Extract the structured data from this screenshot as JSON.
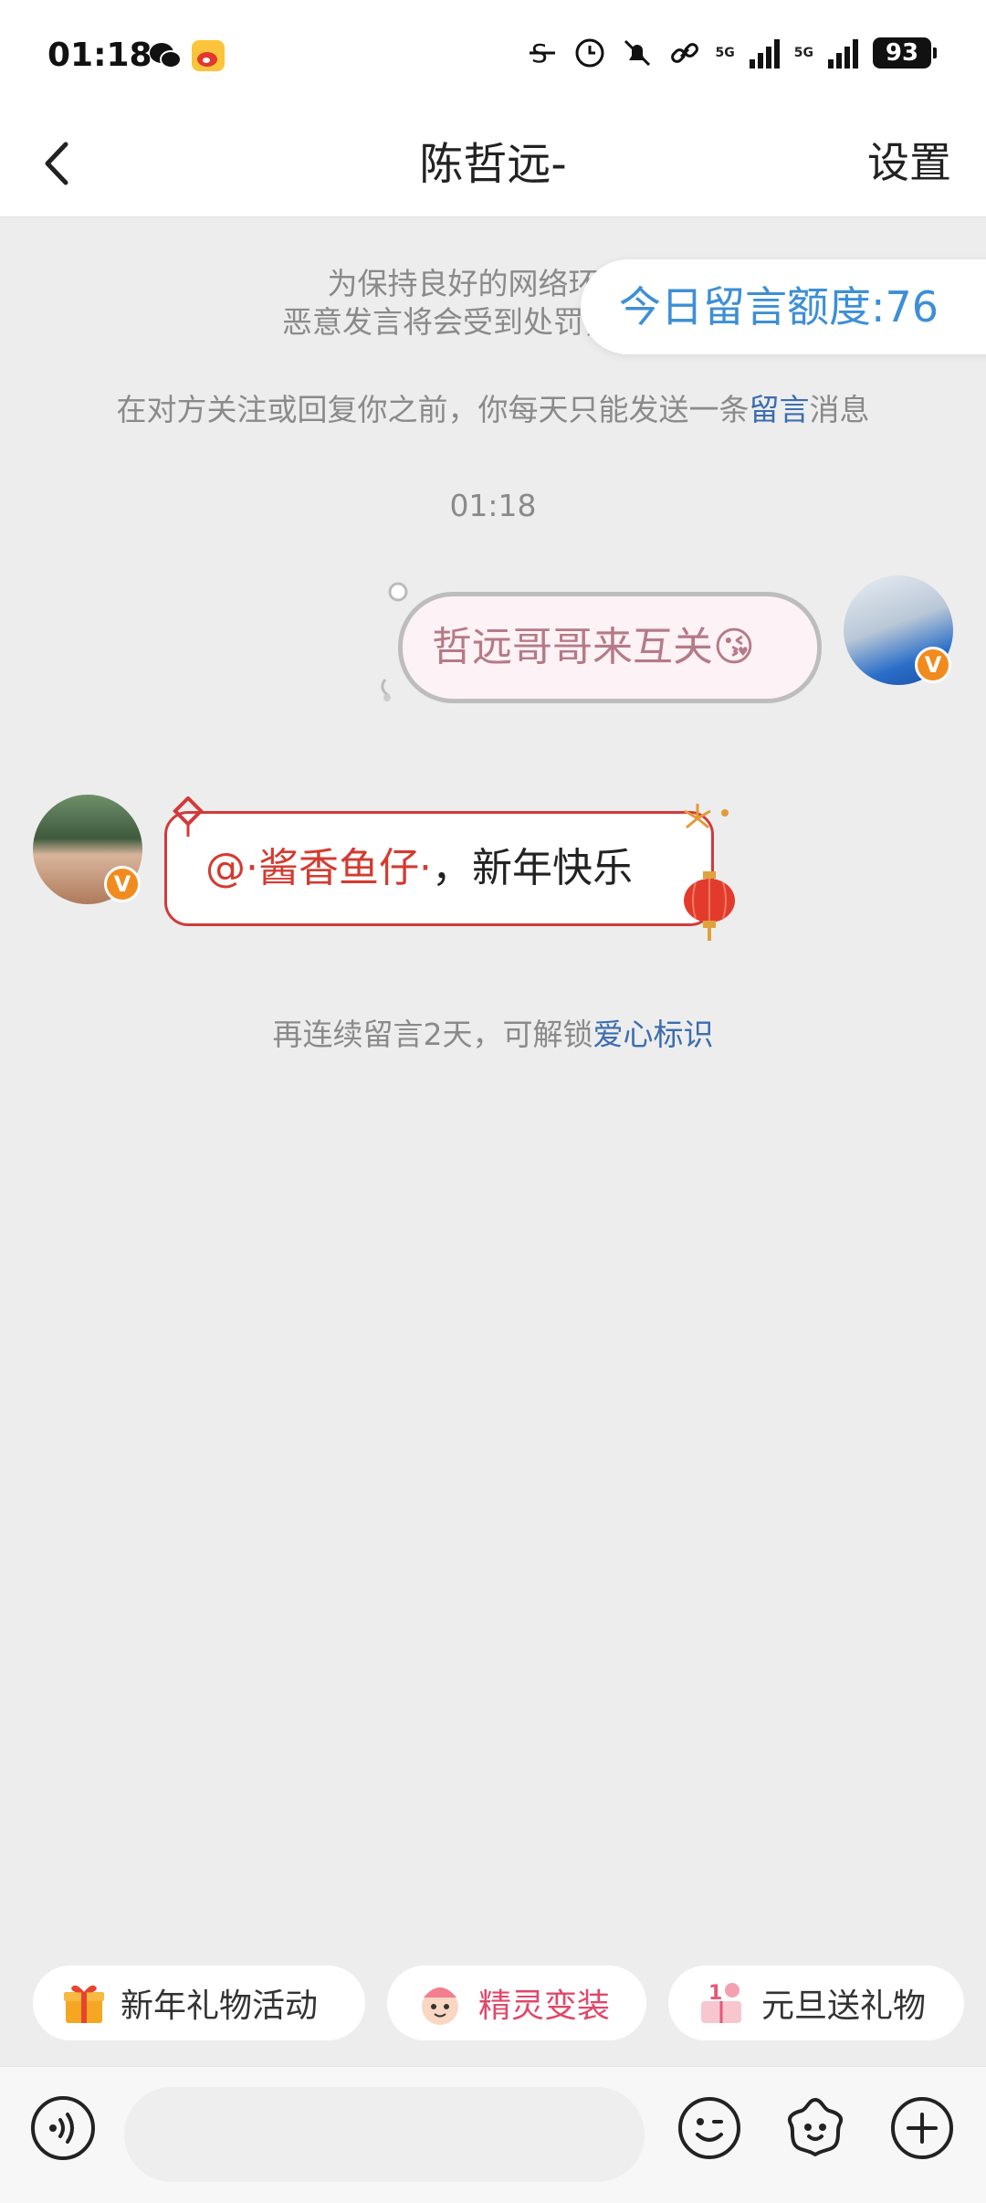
{
  "status_bar": {
    "time": "01:18",
    "network_1": "5G",
    "network_2": "5G",
    "battery": "93",
    "icons": [
      "wechat-icon",
      "weibo-icon",
      "strikethrough-icon",
      "alarm-icon",
      "mute-bell-icon",
      "link-icon",
      "signal-icon",
      "signal-icon",
      "battery-icon"
    ]
  },
  "header": {
    "title": "陈哲远-",
    "settings_label": "设置"
  },
  "notices": {
    "line1": "为保持良好的网络环境，",
    "line2": "恶意发言将会受到处罚，详细细",
    "quota": "今日留言额度:76",
    "limit_prefix": "在对方关注或回复你之前，你每天只能发送一条",
    "limit_link": "留言",
    "limit_suffix": "消息",
    "timestamp": "01:18"
  },
  "messages": [
    {
      "side": "right",
      "text": "哲远哥哥来互关😘",
      "badge": "V"
    },
    {
      "side": "left",
      "mention": "@·酱香鱼仔·",
      "text": "，新年快乐",
      "badge": "V"
    }
  ],
  "system_tip": {
    "prefix": "再连续留言2天，可解锁",
    "link": "爱心标识"
  },
  "quick_actions": [
    {
      "label": "新年礼物活动",
      "icon": "gift-icon"
    },
    {
      "label": "精灵变装",
      "icon": "sprite-icon"
    },
    {
      "label": "元旦送礼物",
      "icon": "newyear-gift-icon"
    }
  ],
  "input": {
    "value": "",
    "placeholder": ""
  },
  "colors": {
    "accent_blue": "#3d8fd6",
    "link_blue": "#3b6db0",
    "mention_red": "#d33b30",
    "badge_orange": "#f28b1e"
  }
}
